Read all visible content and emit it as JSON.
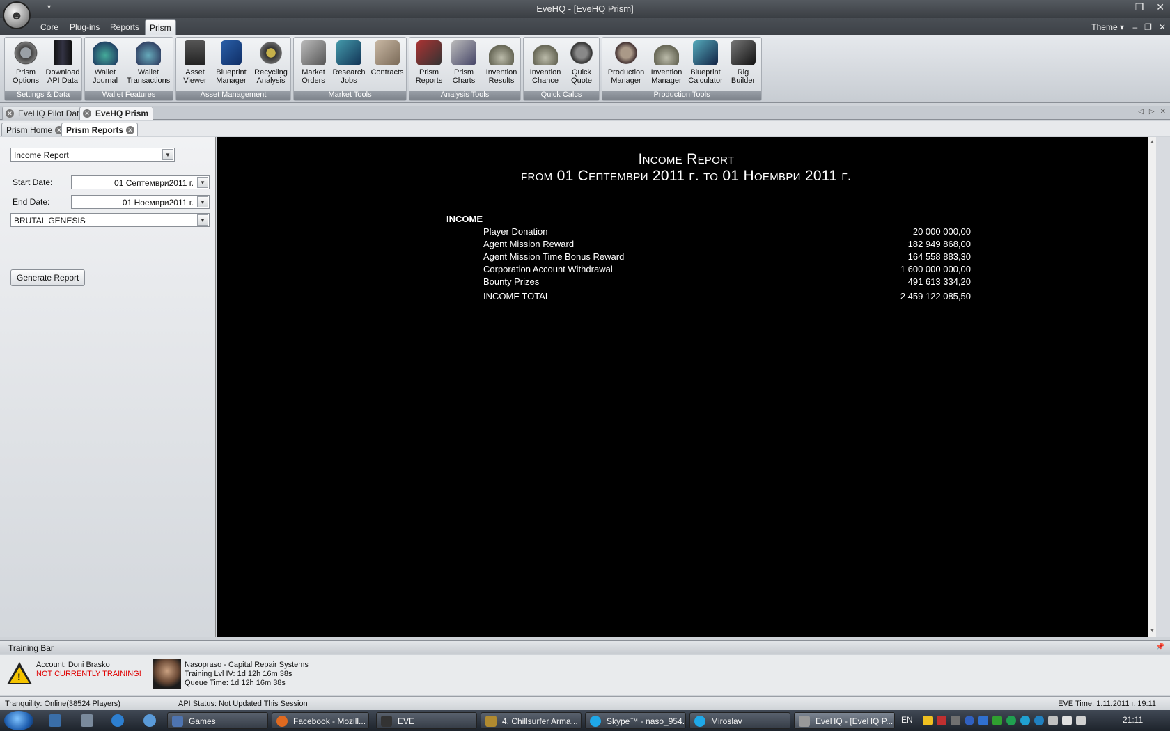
{
  "window": {
    "title": "EveHQ - [EveHQ Prism]",
    "qat_glyph": "▾",
    "logo_glyph": "☻",
    "controls": [
      "–",
      "❐",
      "✕"
    ]
  },
  "ribbon_tabs": [
    "Core",
    "Plug-ins",
    "Reports",
    "Prism"
  ],
  "theme_label": "Theme ▾",
  "mdi_controls": [
    "–",
    "❐",
    "✕"
  ],
  "ribbon_groups": [
    {
      "title": "Settings & Data",
      "buttons": [
        "Prism\nOptions",
        "Download\nAPI Data"
      ]
    },
    {
      "title": "Wallet Features",
      "buttons": [
        "Wallet\nJournal",
        "Wallet\nTransactions"
      ]
    },
    {
      "title": "Asset Management",
      "buttons": [
        "Asset\nViewer",
        "Blueprint\nManager",
        "Recycling\nAnalysis"
      ]
    },
    {
      "title": "Market Tools",
      "buttons": [
        "Market\nOrders",
        "Research\nJobs",
        "Contracts"
      ]
    },
    {
      "title": "Analysis Tools",
      "buttons": [
        "Prism\nReports",
        "Prism\nCharts",
        "Invention\nResults"
      ]
    },
    {
      "title": "Quick Calcs",
      "buttons": [
        "Invention\nChance",
        "Quick\nQuote"
      ]
    },
    {
      "title": "Production Tools",
      "buttons": [
        "Production\nManager",
        "Invention\nManager",
        "Blueprint\nCalculator",
        "Rig\nBuilder"
      ]
    }
  ],
  "doc_tabs": [
    "EveHQ Pilot Data",
    "EveHQ Prism"
  ],
  "doc_nav": [
    "◁",
    "▷",
    "✕"
  ],
  "sub_tabs": [
    "Prism Home",
    "Prism Reports"
  ],
  "close_glyph": "✕",
  "left_panel": {
    "report_type": "Income Report",
    "start_label": "Start Date:",
    "start_value": "01 Септември2011 г.",
    "end_label": "End Date:",
    "end_value": "01 Ноември2011 г.",
    "owner": "BRUTAL GENESIS",
    "generate_button": "Generate Report",
    "dropdown_glyph": "▼"
  },
  "report": {
    "title": "Income Report",
    "subtitle": "from 01 Септември 2011 г. to 01 Ноември 2011 г.",
    "section": "INCOME",
    "rows": [
      {
        "label": "Player Donation",
        "value": "20 000 000,00"
      },
      {
        "label": "Agent Mission Reward",
        "value": "182 949 868,00"
      },
      {
        "label": "Agent Mission Time Bonus Reward",
        "value": "164 558 883,30"
      },
      {
        "label": "Corporation Account Withdrawal",
        "value": "1 600 000 000,00"
      },
      {
        "label": "Bounty Prizes",
        "value": "491 613 334,20"
      }
    ],
    "total_label": "INCOME TOTAL",
    "total_value": "2 459 122 085,50",
    "scroll_up": "▲",
    "scroll_down": "▼"
  },
  "training": {
    "header": "Training Bar",
    "pin_glyph": "📌",
    "account": "Account: Doni Brasko",
    "status": "NOT CURRENTLY TRAINING!",
    "warn_mark": "!",
    "pilot_line1": "Nasopraso - Capital Repair Systems",
    "pilot_line2": "Training Lvl IV: 1d 12h 16m 38s",
    "pilot_line3": "Queue Time: 1d 12h 16m 38s"
  },
  "statusbar": {
    "server": "Tranquility: Online(38524 Players)",
    "api": "API Status: Not Updated This Session",
    "eve_time": "EVE Time: 1.11.2011 г. 19:11"
  },
  "taskbar": {
    "tasks": [
      "Games",
      "Facebook - Mozill...",
      "EVE",
      "4. Chillsurfer Arma...",
      "Skype™ - naso_954...",
      "Miroslav",
      "EveHQ - [EveHQ P..."
    ],
    "language": "EN",
    "clock": "21:11"
  }
}
